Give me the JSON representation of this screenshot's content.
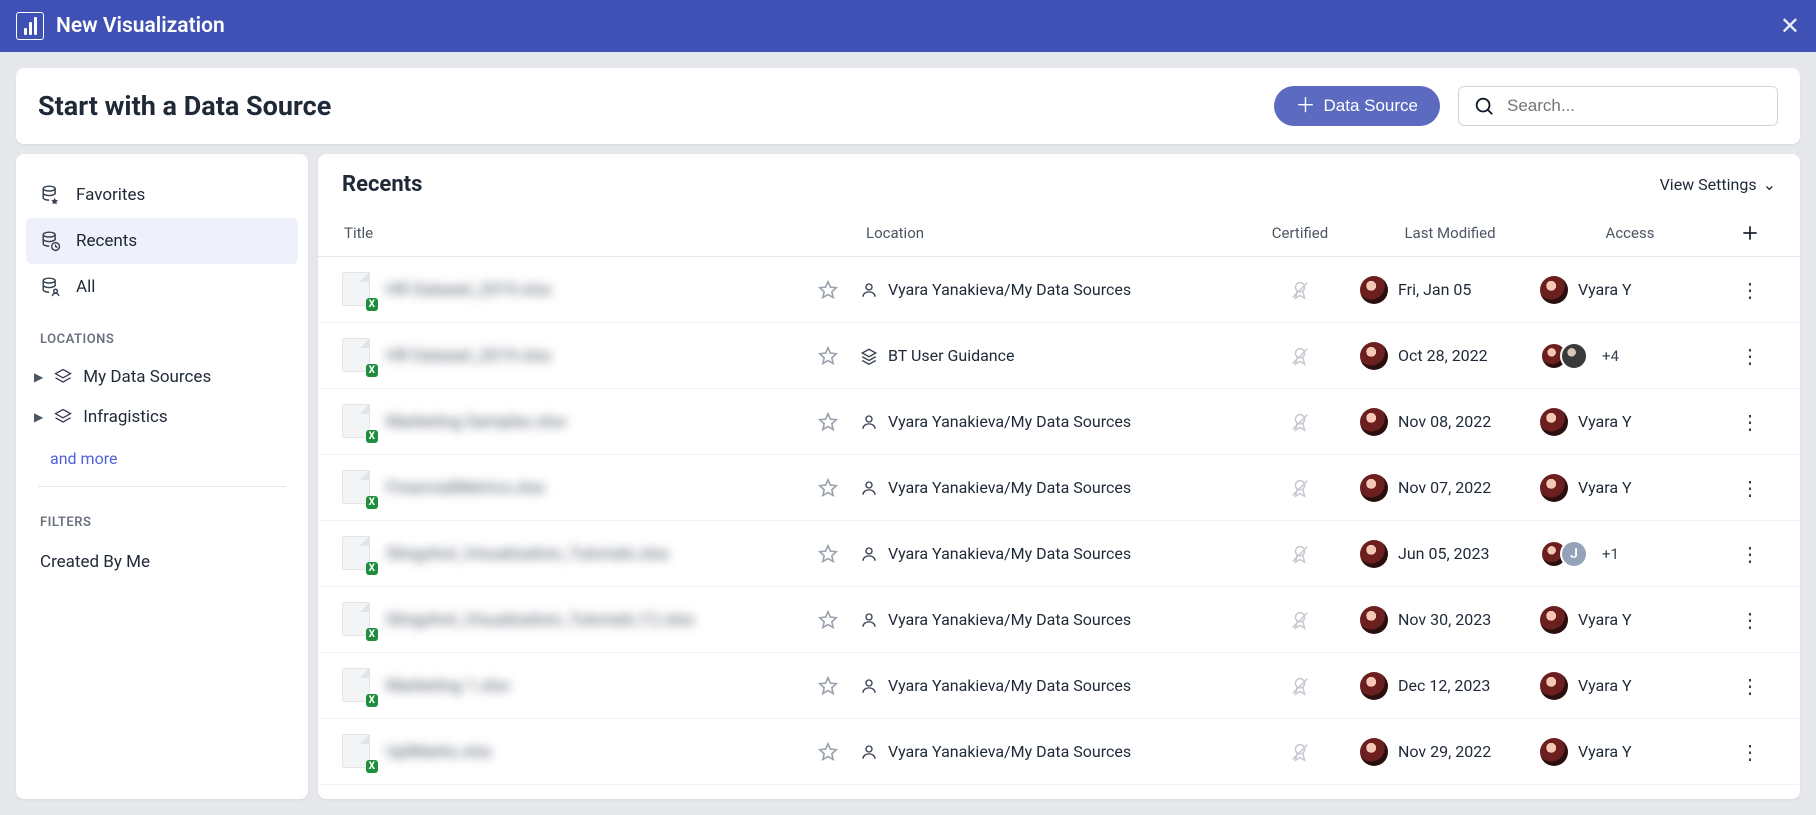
{
  "titlebar": {
    "title": "New Visualization"
  },
  "header": {
    "title": "Start with a Data Source",
    "addButton": "Data Source",
    "searchPlaceholder": "Search..."
  },
  "sidebar": {
    "items": [
      {
        "label": "Favorites",
        "icon": "db-star"
      },
      {
        "label": "Recents",
        "icon": "db-recent",
        "active": true
      },
      {
        "label": "All",
        "icon": "db-user"
      }
    ],
    "locationsLabel": "LOCATIONS",
    "locations": [
      {
        "label": "My Data Sources"
      },
      {
        "label": "Infragistics"
      }
    ],
    "andMore": "and more",
    "filtersLabel": "FILTERS",
    "filters": [
      {
        "label": "Created By Me"
      }
    ]
  },
  "main": {
    "title": "Recents",
    "viewSettings": "View Settings",
    "columns": {
      "title": "Title",
      "location": "Location",
      "certified": "Certified",
      "lastModified": "Last Modified",
      "access": "Access"
    }
  },
  "rows": [
    {
      "title": "HR Dataset_2019.xlsx",
      "locationType": "user",
      "location": "Vyara Yanakieva/My Data Sources",
      "modified": "Fri, Jan 05",
      "access": {
        "kind": "single",
        "name": "Vyara Y"
      }
    },
    {
      "title": "HR Dataset_2019.xlsx",
      "locationType": "stack",
      "location": "BT User Guidance",
      "modified": "Oct 28, 2022",
      "access": {
        "kind": "multi",
        "plus": "+4"
      }
    },
    {
      "title": "Marketing Samples.xlsx",
      "locationType": "user",
      "location": "Vyara Yanakieva/My Data Sources",
      "modified": "Nov 08, 2022",
      "access": {
        "kind": "single",
        "name": "Vyara Y"
      }
    },
    {
      "title": "FinancialMetrics.xlsx",
      "locationType": "user",
      "location": "Vyara Yanakieva/My Data Sources",
      "modified": "Nov 07, 2022",
      "access": {
        "kind": "single",
        "name": "Vyara Y"
      }
    },
    {
      "title": "Slingshot_Visualization_Tutorials.xlsx",
      "locationType": "user",
      "location": "Vyara Yanakieva/My Data Sources",
      "modified": "Jun 05, 2023",
      "access": {
        "kind": "multi-j",
        "plus": "+1"
      }
    },
    {
      "title": "Slingshot_Visualization_Tutorials (1).xlsx",
      "locationType": "user",
      "location": "Vyara Yanakieva/My Data Sources",
      "modified": "Nov 30, 2023",
      "access": {
        "kind": "single",
        "name": "Vyara Y"
      }
    },
    {
      "title": "Marketing 1.xlsx",
      "locationType": "user",
      "location": "Vyara Yanakieva/My Data Sources",
      "modified": "Dec 12, 2023",
      "access": {
        "kind": "single",
        "name": "Vyara Y"
      }
    },
    {
      "title": "UplMarks.xlsx",
      "locationType": "user",
      "location": "Vyara Yanakieva/My Data Sources",
      "modified": "Nov 29, 2022",
      "access": {
        "kind": "single",
        "name": "Vyara Y"
      }
    }
  ]
}
